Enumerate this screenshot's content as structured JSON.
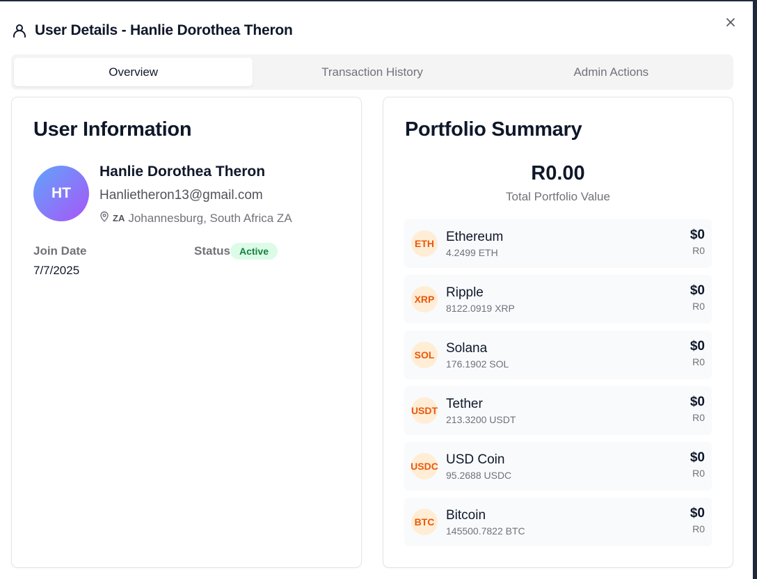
{
  "dialog": {
    "title": "User Details - Hanlie Dorothea Theron",
    "icons": {
      "title": "user-icon",
      "close": "close-icon"
    }
  },
  "tabs": [
    {
      "label": "Overview",
      "active": true
    },
    {
      "label": "Transaction History",
      "active": false
    },
    {
      "label": "Admin Actions",
      "active": false
    }
  ],
  "user_info": {
    "heading": "User Information",
    "initials": "HT",
    "name": "Hanlie Dorothea Theron",
    "email": "Hanlietheron13@gmail.com",
    "location_flag": "ZA",
    "location": "Johannesburg, South Africa ZA",
    "join_label": "Join Date",
    "join_date": "7/7/2025",
    "status_label": "Status",
    "status": "Active"
  },
  "portfolio": {
    "heading": "Portfolio Summary",
    "total_value": "R0.00",
    "total_label": "Total Portfolio Value",
    "assets": [
      {
        "symbol": "ETH",
        "name": "Ethereum",
        "amount": "4.2499 ETH",
        "usd": "$0",
        "zar": "R0"
      },
      {
        "symbol": "XRP",
        "name": "Ripple",
        "amount": "8122.0919 XRP",
        "usd": "$0",
        "zar": "R0"
      },
      {
        "symbol": "SOL",
        "name": "Solana",
        "amount": "176.1902 SOL",
        "usd": "$0",
        "zar": "R0"
      },
      {
        "symbol": "USDT",
        "name": "Tether",
        "amount": "213.3200 USDT",
        "usd": "$0",
        "zar": "R0"
      },
      {
        "symbol": "USDC",
        "name": "USD Coin",
        "amount": "95.2688 USDC",
        "usd": "$0",
        "zar": "R0"
      },
      {
        "symbol": "BTC",
        "name": "Bitcoin",
        "amount": "145500.7822 BTC",
        "usd": "$0",
        "zar": "R0"
      }
    ]
  },
  "colors": {
    "status_active_bg": "#dcfce7",
    "status_active_text": "#15803d",
    "coin_bg": "#ffedd5",
    "coin_text": "#ea580c",
    "avatar_gradient_start": "#60a5fa",
    "avatar_gradient_end": "#a855f7"
  }
}
